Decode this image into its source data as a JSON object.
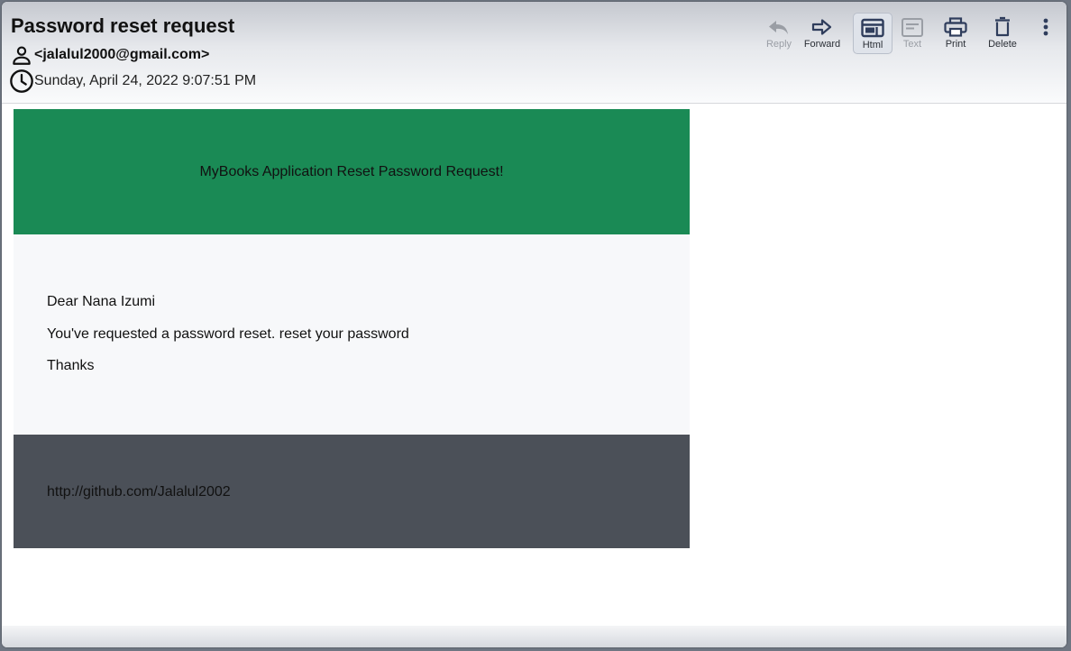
{
  "email": {
    "subject": "Password reset request",
    "sender": "<jalalul2000@gmail.com>",
    "date": "Sunday, April 24, 2022 9:07:51 PM"
  },
  "toolbar": {
    "reply_label": "Reply",
    "forward_label": "Forward",
    "html_label": "Html",
    "text_label": "Text",
    "print_label": "Print",
    "delete_label": "Delete",
    "active_view": "Html"
  },
  "message": {
    "banner": "MyBooks Application Reset Password Request!",
    "greeting": "Dear Nana Izumi",
    "line1": "You've requested a password reset. reset your password",
    "closing": "Thanks",
    "footer_link": "http://github.com/Jalalul2002"
  },
  "colors": {
    "banner_bg": "#1a8a55",
    "content_bg": "#f7f8fa",
    "footer_bg": "#4b5058",
    "icon_active": "#2f3d5c",
    "icon_disabled": "#9a9ea5"
  },
  "icons": {
    "sender": "person-icon",
    "date": "clock-icon",
    "reply": "reply-arrow-icon",
    "forward": "forward-arrow-icon",
    "html": "html-view-icon",
    "text": "text-view-icon",
    "print": "printer-icon",
    "delete": "trash-icon",
    "more": "kebab-menu-icon"
  }
}
